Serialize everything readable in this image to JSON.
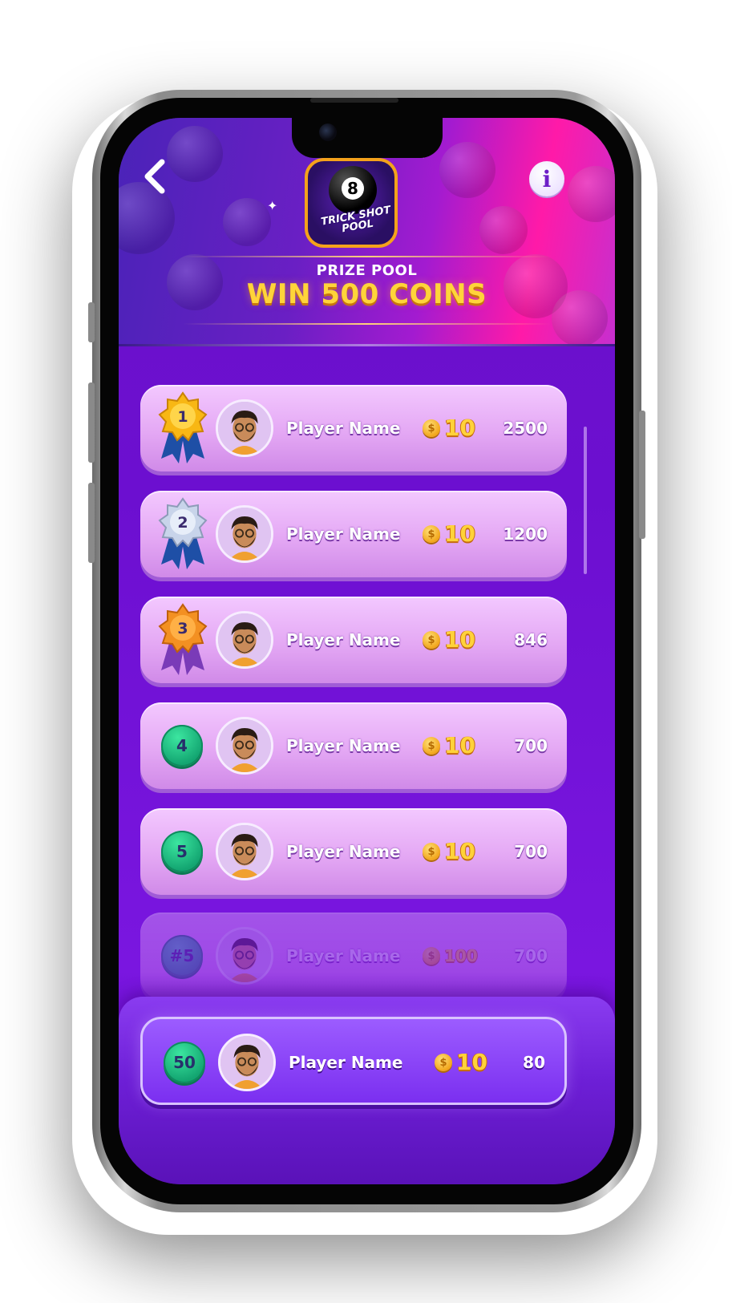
{
  "header": {
    "back_label": "Back",
    "info_label": "i",
    "logo": {
      "ball_number": "8",
      "title": "TRICK SHOT POOL"
    },
    "prize_label": "PRIZE POOL",
    "prize_value": "WIN 500 COINS"
  },
  "leaderboard": {
    "rows": [
      {
        "rank": "1",
        "rank_style": "gold-medal",
        "name": "Player Name",
        "reward": "10",
        "score": "2500"
      },
      {
        "rank": "2",
        "rank_style": "silver-medal",
        "name": "Player Name",
        "reward": "10",
        "score": "1200"
      },
      {
        "rank": "3",
        "rank_style": "bronze-medal",
        "name": "Player Name",
        "reward": "10",
        "score": "846"
      },
      {
        "rank": "4",
        "rank_style": "green-circle",
        "name": "Player Name",
        "reward": "10",
        "score": "700"
      },
      {
        "rank": "5",
        "rank_style": "green-circle",
        "name": "Player Name",
        "reward": "10",
        "score": "700"
      },
      {
        "rank": "#5",
        "rank_style": "green-circle",
        "name": "Player Name",
        "reward": "100",
        "score": "700"
      }
    ]
  },
  "current_player": {
    "rank": "50",
    "name": "Player Name",
    "reward": "10",
    "score": "80"
  },
  "coin_symbol": "$",
  "colors": {
    "accent_purple": "#6c0fd0",
    "row_pink": "#e4a8f4",
    "gold": "#ffd23a",
    "rank_green": "#13a571"
  }
}
